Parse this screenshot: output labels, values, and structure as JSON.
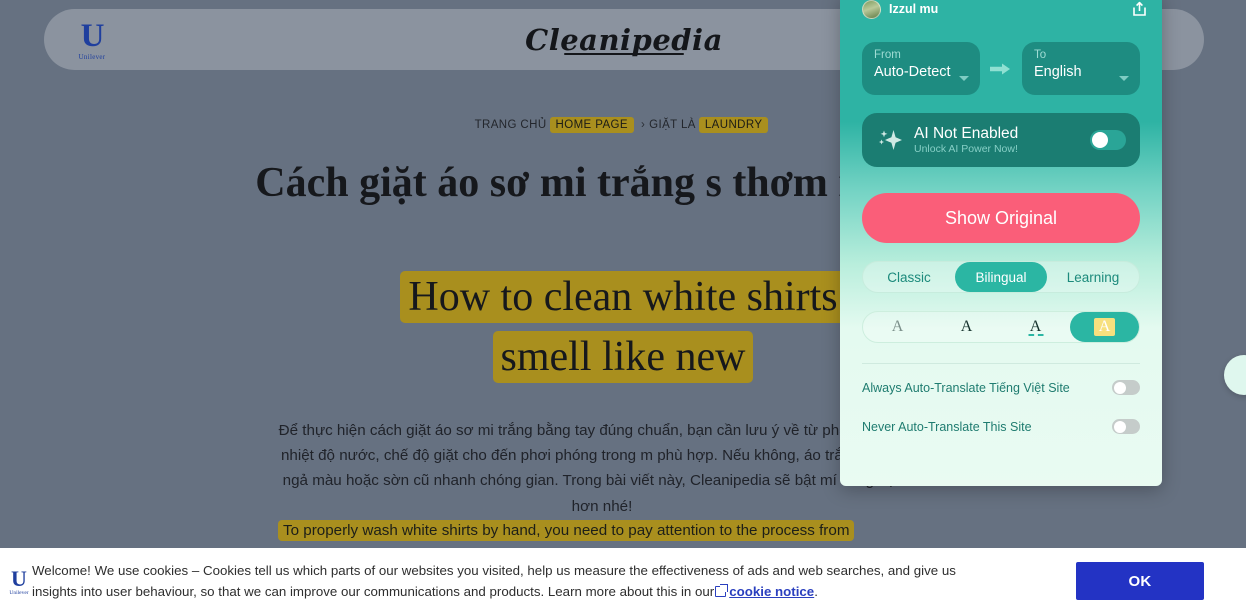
{
  "page": {
    "site_logo": "Cleanipedia",
    "brand_logo": "Unilever",
    "brand_mark": "U",
    "breadcrumb": {
      "item1_vi": "TRANG CHỦ",
      "item1_en": "HOME PAGE",
      "separator": "›",
      "item2_vi": "GIẶT LÀ",
      "item2_en": "LAUNDRY"
    },
    "headline_vi": "Cách giặt áo sơ mi trắng s       thơm như mới",
    "headline_en_line1": "How to clean white shirts",
    "headline_en_line2": "smell like new",
    "body_vi": "Để thực hiện cách giặt áo sơ mi trắng bằng tay đúng chuẩn, bạn cần lưu ý về từ phân loại, chọn nhiệt độ nước, chế độ giặt cho đến phơi phóng trong m phù hợp. Nếu không, áo trắng sẽ rất dễ ngả màu hoặc sờn cũ nhanh chóng gian. Trong bài viết này, Cleanipedia sẽ bật mí cùng bạn rõ hơn nhé!",
    "body_en": "To properly wash white shirts by hand, you need to pay attention to the process from"
  },
  "cookie_banner": {
    "text_part1": "Welcome! We use cookies – Cookies tell us which parts of our websites you visited, help us measure the effectiveness of ads and web searches, and give us insights into user behaviour, so that we can improve our communications and products. Learn more about this in our",
    "link_label": "cookie notice",
    "period": ".",
    "ok_label": "OK",
    "ok_color": "#2333c4"
  },
  "translator": {
    "username": "Izzul mu",
    "from": {
      "label": "From",
      "value": "Auto-Detect"
    },
    "to": {
      "label": "To",
      "value": "English"
    },
    "ai": {
      "title": "AI Not Enabled",
      "subtitle": "Unlock AI Power Now!",
      "enabled": false
    },
    "show_original_label": "Show Original",
    "show_original_color": "#fa5e79",
    "modes": [
      {
        "label": "Classic",
        "active": false
      },
      {
        "label": "Bilingual",
        "active": true
      },
      {
        "label": "Learning",
        "active": false
      }
    ],
    "styles": [
      {
        "glyph": "A",
        "variant": "plain",
        "active": false
      },
      {
        "glyph": "A",
        "variant": "bold",
        "active": false
      },
      {
        "glyph": "A",
        "variant": "dashed",
        "active": false
      },
      {
        "glyph": "A",
        "variant": "highlight",
        "active": true
      }
    ],
    "settings": [
      {
        "label": "Always Auto-Translate Tiếng Việt Site",
        "on": false
      },
      {
        "label": "Never Auto-Translate This Site",
        "on": false
      }
    ],
    "accent_color": "#2bb6a3"
  }
}
